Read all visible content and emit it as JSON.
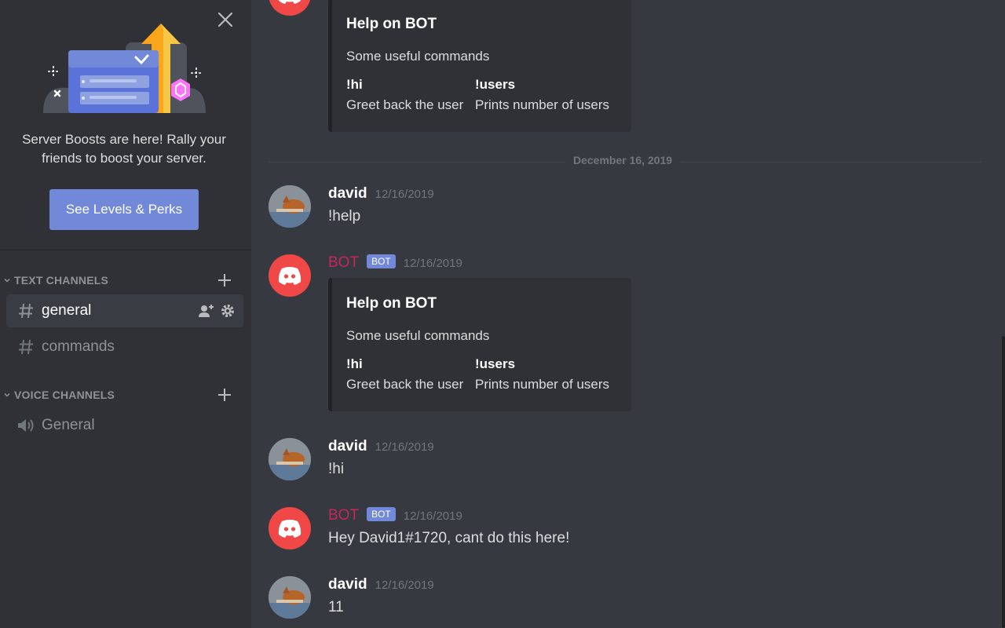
{
  "sidebar": {
    "promo": {
      "text": "Server Boosts are here! Rally your friends to boost your server.",
      "button_label": "See Levels & Perks"
    },
    "text_channels_label": "TEXT CHANNELS",
    "voice_channels_label": "VOICE CHANNELS",
    "text_channels": [
      {
        "name": "general",
        "active": true
      },
      {
        "name": "commands",
        "active": false
      }
    ],
    "voice_channels": [
      {
        "name": "General"
      }
    ]
  },
  "chat": {
    "date_divider": "December 16, 2019",
    "embed": {
      "title": "Help on BOT",
      "description": "Some useful commands",
      "fields": [
        {
          "name": "!hi",
          "value": "Greet back the user"
        },
        {
          "name": "!users",
          "value": "Prints number of users"
        }
      ]
    },
    "messages": [
      {
        "author": "david",
        "timestamp": "12/16/2019",
        "text": "!help"
      },
      {
        "author": "BOT",
        "tag": "BOT",
        "timestamp": "12/16/2019"
      },
      {
        "author": "david",
        "timestamp": "12/16/2019",
        "text": "!hi"
      },
      {
        "author": "BOT",
        "tag": "BOT",
        "timestamp": "12/16/2019",
        "text": "Hey David1#1720, cant do this here!"
      },
      {
        "author": "david",
        "timestamp": "12/16/2019",
        "text": "11"
      }
    ]
  },
  "colors": {
    "accent": "#7289da",
    "bot_name": "#c6285a",
    "bot_avatar": "#f04747",
    "background": "#36393f",
    "sidebar": "#2f3136"
  }
}
